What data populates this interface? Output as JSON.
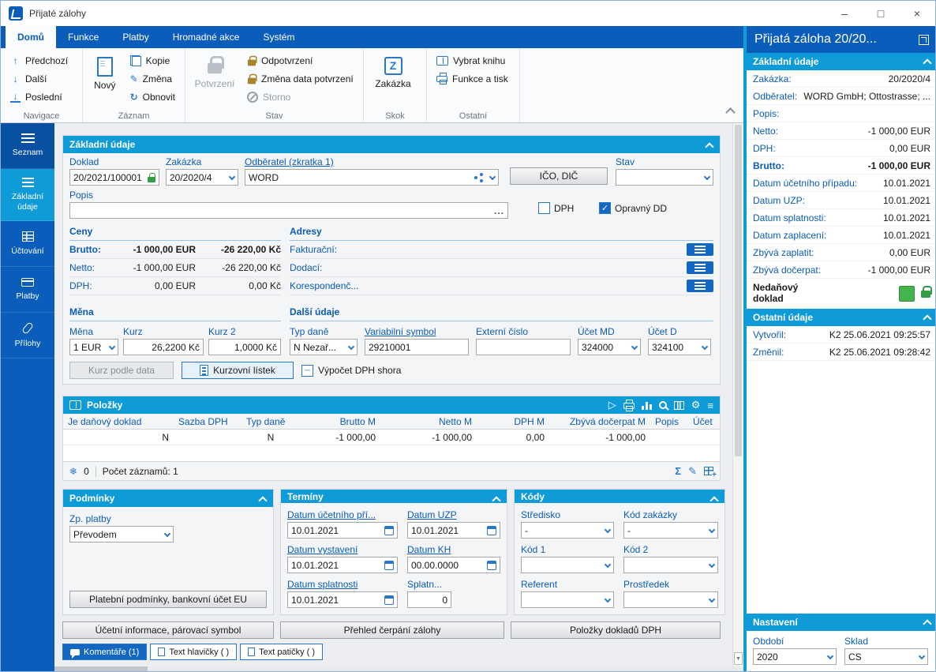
{
  "icons": {
    "minimize": "–",
    "maximize": "□",
    "close": "×",
    "up": "↑",
    "down": "↓",
    "refresh": "↻",
    "pencil": "✎",
    "play": "▷",
    "gear": "⚙",
    "menu": "≡",
    "sum": "Σ",
    "snowflake": "❄",
    "scroll_down": "▼",
    "ellipsis": "...",
    "zakazka_letter": "Z"
  },
  "window": {
    "title": "Přijaté zálohy"
  },
  "ribbon": {
    "tabs": [
      "Domů",
      "Funkce",
      "Platby",
      "Hromadné akce",
      "Systém"
    ],
    "navigace": {
      "predchozi": "Předchozí",
      "dalsi": "Další",
      "posledni": "Poslední",
      "label": "Navigace"
    },
    "zaznam": {
      "novy": "Nový",
      "kopie": "Kopie",
      "zmena": "Změna",
      "obnovit": "Obnovit",
      "label": "Záznam"
    },
    "stav": {
      "potvrzeni": "Potvrzení",
      "odpotvrzeni": "Odpotvrzení",
      "zmena_data": "Změna data potvrzení",
      "storno": "Storno",
      "label": "Stav"
    },
    "skok": {
      "zakazka": "Zakázka",
      "label": "Skok"
    },
    "ostatni": {
      "vybrat_knihu": "Vybrat knihu",
      "funkce_a_tisk": "Funkce a tisk",
      "label": "Ostatní"
    }
  },
  "sidebar": {
    "items": [
      {
        "label": "Seznam"
      },
      {
        "label": "Základní údaje"
      },
      {
        "label": "Účtování"
      },
      {
        "label": "Platby"
      },
      {
        "label": "Přílohy"
      }
    ]
  },
  "basic": {
    "title": "Základní údaje",
    "doklad": {
      "label": "Doklad",
      "value": "20/2021/100001"
    },
    "zakazka": {
      "label": "Zakázka",
      "value": "20/2020/4"
    },
    "odberatel": {
      "label": "Odběratel (zkratka 1)",
      "value": "WORD"
    },
    "ico_dic": "IČO, DIČ",
    "stav": {
      "label": "Stav",
      "value": ""
    },
    "popis": {
      "label": "Popis",
      "value": ""
    },
    "dph_cb": "DPH",
    "opravny_dd_cb": "Opravný DD",
    "ceny": {
      "title": "Ceny",
      "rows": [
        {
          "label": "Brutto:",
          "eur": "-1 000,00 EUR",
          "kc": "-26 220,00 Kč"
        },
        {
          "label": "Netto:",
          "eur": "-1 000,00 EUR",
          "kc": "-26 220,00 Kč"
        },
        {
          "label": "DPH:",
          "eur": "0,00 EUR",
          "kc": "0,00 Kč"
        }
      ]
    },
    "adresy": {
      "title": "Adresy",
      "rows": [
        {
          "label": "Fakturační:"
        },
        {
          "label": "Dodací:"
        },
        {
          "label": "Korespondenč..."
        }
      ]
    },
    "mena": {
      "title": "Měna",
      "mena": {
        "label": "Měna",
        "value": "1 EUR"
      },
      "kurz": {
        "label": "Kurz",
        "value": "26,2200 Kč"
      },
      "kurz2": {
        "label": "Kurz 2",
        "value": "1,0000 Kč"
      }
    },
    "dalsi": {
      "title": "Další údaje",
      "typ_dane": {
        "label": "Typ daně",
        "value": "N Nezař..."
      },
      "var_symbol": {
        "label": "Variabilní symbol",
        "value": "29210001"
      },
      "externi": {
        "label": "Externí číslo",
        "value": ""
      },
      "ucet_md": {
        "label": "Účet MD",
        "value": "324000"
      },
      "ucet_d": {
        "label": "Účet D",
        "value": "324100"
      }
    },
    "kurz_podle_data": "Kurz podle data",
    "kurzovni_listek": "Kurzovní lístek",
    "vypocet_dph": "Výpočet DPH shora"
  },
  "polozky": {
    "title": "Položky",
    "columns": [
      "Je daňový doklad",
      "Sazba DPH",
      "Typ daně",
      "Brutto M",
      "Netto M",
      "DPH M",
      "Zbývá dočerpat M",
      "Popis",
      "Účet"
    ],
    "row": [
      "N",
      "",
      "N",
      "-1 000,00",
      "-1 000,00",
      "0,00",
      "-1 000,00",
      "",
      ""
    ],
    "badge": "0",
    "count": "Počet záznamů: 1"
  },
  "podminky": {
    "title": "Podmínky",
    "zp_platby": {
      "label": "Zp. platby",
      "value": "Převodem"
    },
    "button": "Platební podmínky, bankovní účet EU"
  },
  "terminy": {
    "title": "Termíny",
    "fields": [
      {
        "label": "Datum účetního pří...",
        "value": "10.01.2021"
      },
      {
        "label": "Datum UZP",
        "value": "10.01.2021"
      },
      {
        "label": "Datum vystavení",
        "value": "10.01.2021"
      },
      {
        "label": "Datum KH",
        "value": "00.00.0000"
      },
      {
        "label": "Datum splatnosti",
        "value": "10.01.2021"
      },
      {
        "label": "Splatn...",
        "value": "0"
      }
    ]
  },
  "kody": {
    "title": "Kódy",
    "fields": [
      {
        "label": "Středisko",
        "value": "-"
      },
      {
        "label": "Kód zakázky",
        "value": "-"
      },
      {
        "label": "Kód 1",
        "value": ""
      },
      {
        "label": "Kód 2",
        "value": ""
      },
      {
        "label": "Referent",
        "value": ""
      },
      {
        "label": "Prostředek",
        "value": ""
      }
    ]
  },
  "bottom_buttons": [
    "Účetní informace, párovací symbol",
    "Přehled čerpání zálohy",
    "Položky dokladů DPH"
  ],
  "bottom_tabs": [
    {
      "label": "Komentáře (1)"
    },
    {
      "label": "Text hlavičky ( )"
    },
    {
      "label": "Text patičky ( )"
    }
  ],
  "right": {
    "title": "Přijatá záloha 20/20...",
    "zakladni": {
      "title": "Základní údaje",
      "rows": [
        {
          "label": "Zakázka:",
          "value": "20/2020/4"
        },
        {
          "label": "Odběratel:",
          "value": "WORD GmbH; Ottostrasse; ..."
        },
        {
          "label": "Popis:",
          "value": ""
        },
        {
          "label": "Netto:",
          "value": "-1 000,00 EUR"
        },
        {
          "label": "DPH:",
          "value": "0,00 EUR"
        },
        {
          "label": "Brutto:",
          "value": "-1 000,00 EUR"
        },
        {
          "label": "Datum účetního případu:",
          "value": "10.01.2021"
        },
        {
          "label": "Datum UZP:",
          "value": "10.01.2021"
        },
        {
          "label": "Datum splatnosti:",
          "value": "10.01.2021"
        },
        {
          "label": "Datum zaplacení:",
          "value": "10.01.2021"
        },
        {
          "label": "Zbývá zaplatit:",
          "value": "0,00 EUR"
        },
        {
          "label": "Zbývá dočerpat:",
          "value": "-1 000,00 EUR"
        }
      ],
      "nedanovy": "Nedaňový doklad"
    },
    "ostatni": {
      "title": "Ostatní údaje",
      "rows": [
        {
          "label": "Vytvořil:",
          "value": "K2 25.06.2021 09:25:57"
        },
        {
          "label": "Změnil:",
          "value": "K2 25.06.2021 09:28:42"
        }
      ]
    },
    "nastaveni": {
      "title": "Nastavení",
      "obdobi": {
        "label": "Období",
        "value": "2020"
      },
      "sklad": {
        "label": "Sklad",
        "value": "CS"
      }
    }
  }
}
